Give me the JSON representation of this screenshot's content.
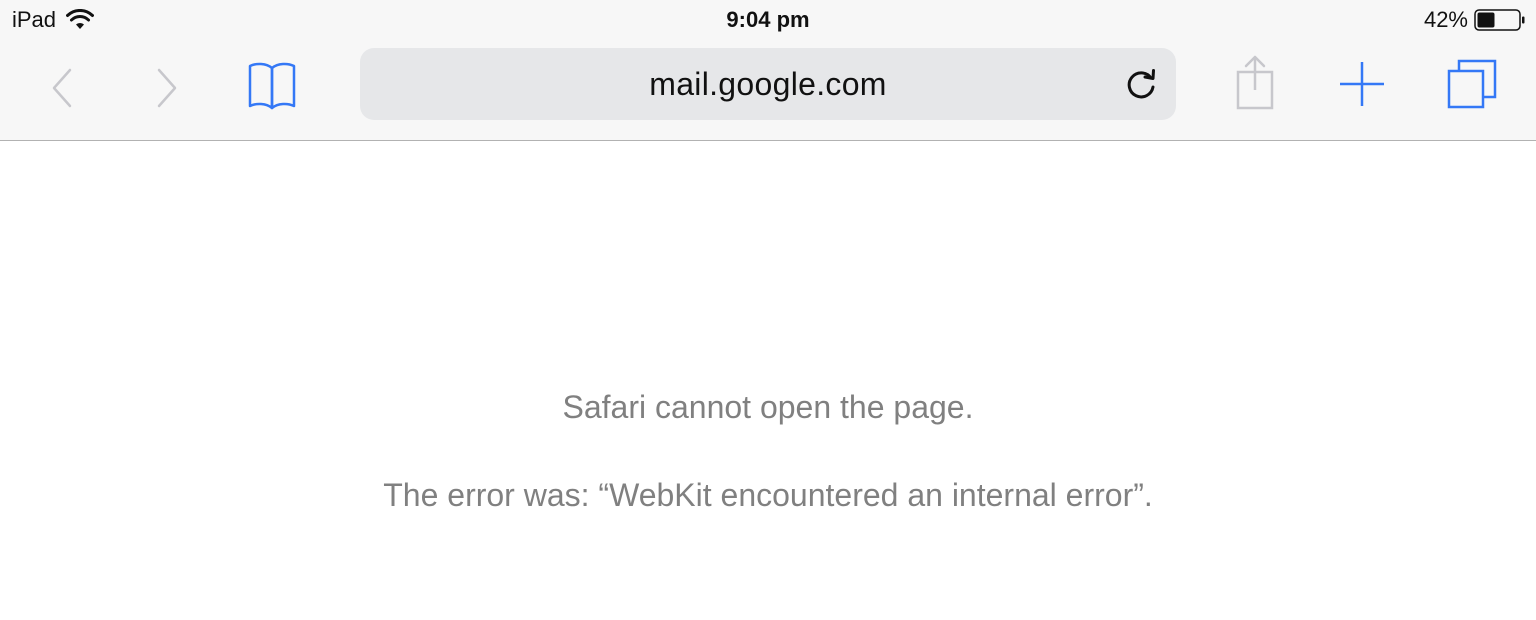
{
  "status_bar": {
    "device": "iPad",
    "time": "9:04 pm",
    "battery_percent": "42%",
    "battery_level": 0.42
  },
  "toolbar": {
    "url": "mail.google.com",
    "icons": [
      "back-chevron-icon",
      "forward-chevron-icon",
      "bookmarks-book-icon",
      "reload-icon",
      "share-icon",
      "new-tab-plus-icon",
      "tabs-overview-icon"
    ],
    "accent_color": "#3478f6",
    "disabled_color": "#c7c7cc"
  },
  "page": {
    "error_title": "Safari cannot open the page.",
    "error_detail": "The error was: “WebKit encountered an internal error”."
  }
}
